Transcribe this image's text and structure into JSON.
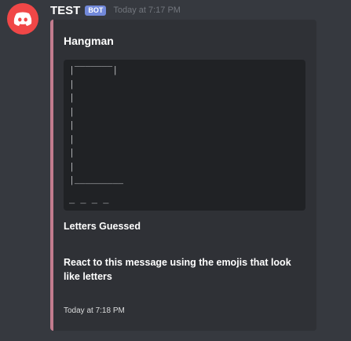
{
  "message": {
    "author": "TEST",
    "badge": "BOT",
    "timestamp": "Today at 7:17 PM",
    "avatar_icon": "discord-logo-icon",
    "avatar_color": "#f04747"
  },
  "embed": {
    "accent_color": "#c27c8e",
    "title": "Hangman",
    "gallows": "|‾‾‾‾‾‾‾|\n|\n|\n|\n|\n|\n|\n|\n|_________",
    "word_blanks": "_ _ _ _",
    "field_name": "Letters Guessed",
    "description": "React to this message using the emojis that look like letters",
    "footer": "Today at 7:18 PM"
  }
}
